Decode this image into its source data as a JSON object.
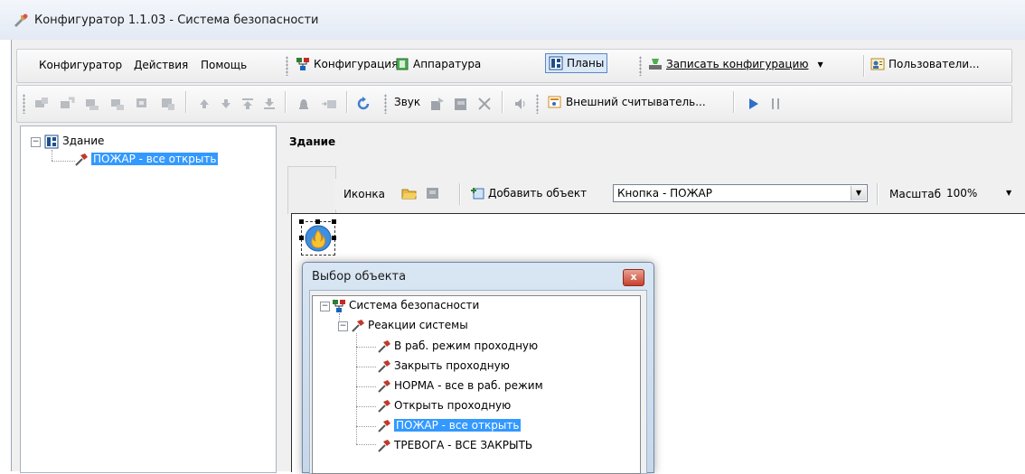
{
  "window": {
    "title": "Конфигуратор 1.1.03 - Система безопасности",
    "app_icon": "configurator-app-icon"
  },
  "menu": {
    "items": [
      "Конфигуратор",
      "Действия",
      "Помощь"
    ]
  },
  "toolbar_main": {
    "config_label": "Конфигурация",
    "hardware_label": "Аппаратура",
    "plans_label": "Планы",
    "write_config_label": "Записать конфигурацию",
    "users_label": "Пользователи..."
  },
  "toolbar_secondary": {
    "sound_label": "Звук",
    "reader_label": "Внешний считыватель...",
    "icons": [
      "add-node-icon",
      "add-child-icon",
      "add-sibling-icon",
      "remove-node-icon",
      "copy-node-icon",
      "paste-node-icon",
      "move-up-icon",
      "move-down-icon",
      "move-top-icon",
      "move-bottom-icon",
      "bell-icon",
      "add-tab-icon",
      "refresh-icon",
      "sound-play-icon",
      "sound-stop-icon",
      "delete-icon",
      "speaker-icon",
      "play-icon",
      "pause-icon"
    ]
  },
  "left_tree": {
    "root": "Здание",
    "child": "ПОЖАР - все открыть"
  },
  "plan": {
    "header": "Здание",
    "icon_label": "Иконка",
    "add_object_label": "Добавить объект",
    "object_combo_value": "Кнопка - ПОЖАР",
    "scale_label": "Масштаб",
    "scale_value": "100%"
  },
  "dialog": {
    "title": "Выбор объекта",
    "close_glyph": "x",
    "root": "Система безопасности",
    "group": "Реакции системы",
    "items": [
      "В раб. режим проходную",
      "Закрыть проходную",
      "НОРМА - все в раб. режим",
      "Открыть проходную",
      "ПОЖАР - все открыть",
      "ТРЕВОГА - ВСЕ ЗАКРЫТЬ"
    ],
    "selected_index": 4
  },
  "colors": {
    "selection": "#3399ff",
    "accent": "#5b87c5"
  }
}
